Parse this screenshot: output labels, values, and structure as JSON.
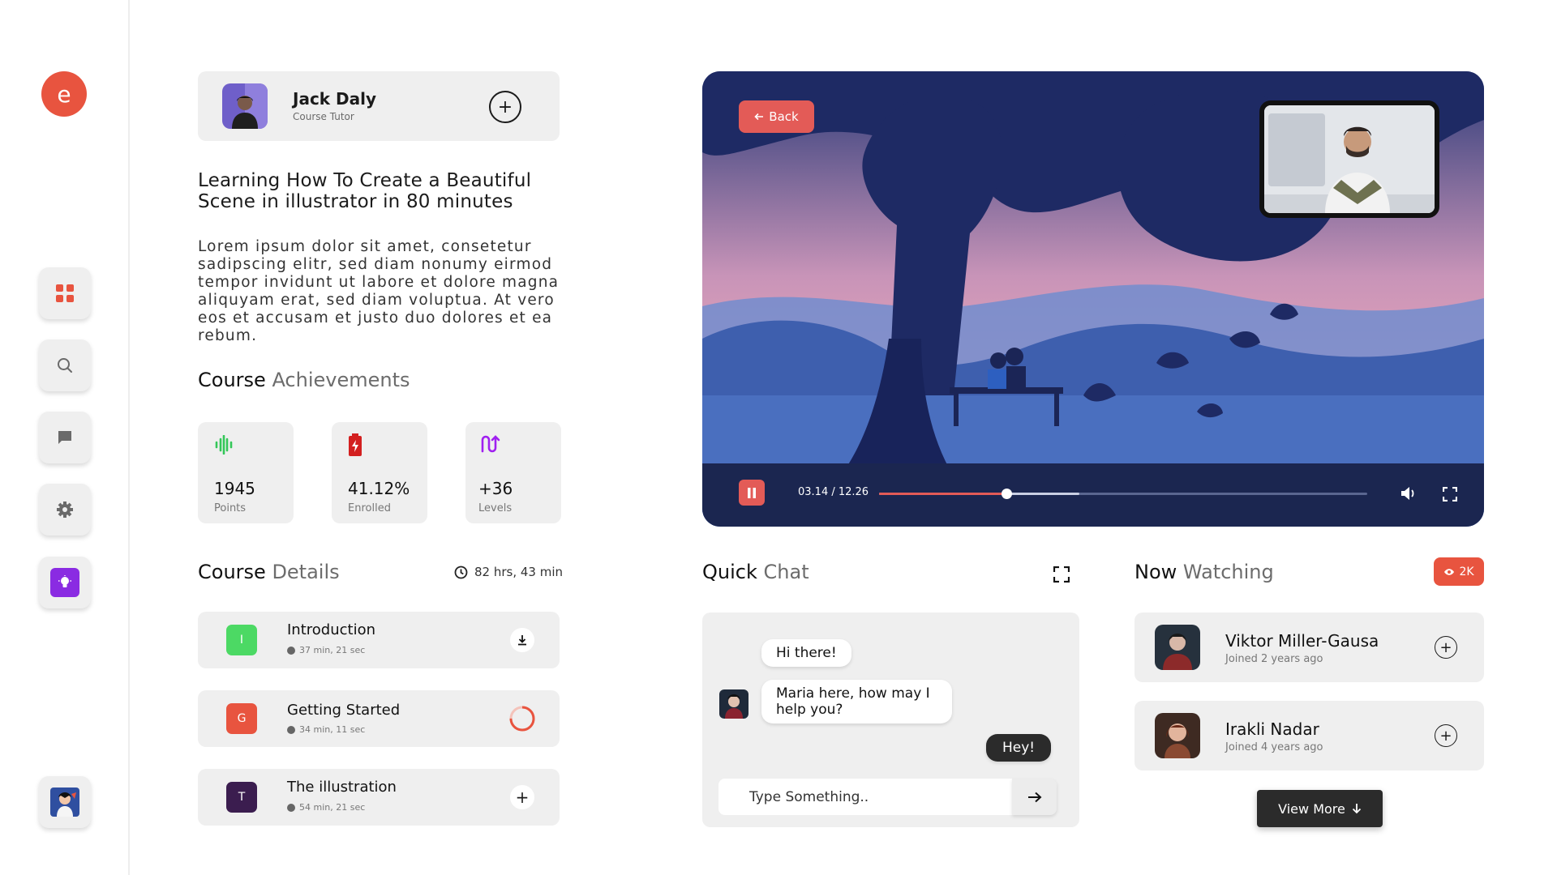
{
  "brand": {
    "logo_letter": "e",
    "accent": "#e8543f"
  },
  "sidebar": {
    "items": [
      {
        "name": "dashboard",
        "icon": "grid-icon",
        "active": true
      },
      {
        "name": "search",
        "icon": "search-icon"
      },
      {
        "name": "messages",
        "icon": "chat-icon"
      },
      {
        "name": "settings",
        "icon": "gear-icon"
      },
      {
        "name": "ideas",
        "icon": "bulb-icon",
        "color": "#8a2be2"
      }
    ]
  },
  "tutor": {
    "name": "Jack Daly",
    "role": "Course Tutor"
  },
  "course": {
    "title": "Learning How To Create a Beautiful Scene in illustrator in 80 minutes",
    "description": "Lorem ipsum dolor sit amet, consetetur sadipscing elitr, sed diam nonumy eirmod tempor invidunt ut labore et dolore magna aliquyam erat, sed diam voluptua. At vero eos et accusam et justo duo dolores et ea rebum."
  },
  "achievements": {
    "title_bold": "Course",
    "title_light": "Achievements",
    "items": [
      {
        "value": "1945",
        "label": "Points",
        "icon": "soundwave-icon",
        "color": "#34c759"
      },
      {
        "value": "41.12%",
        "label": "Enrolled",
        "icon": "battery-icon",
        "color": "#d32020"
      },
      {
        "value": "+36",
        "label": "Levels",
        "icon": "route-icon",
        "color": "#a020f0"
      }
    ]
  },
  "details": {
    "title_bold": "Course",
    "title_light": "Details",
    "duration": "82 hrs, 43 min",
    "lessons": [
      {
        "letter": "I",
        "name": "Introduction",
        "time": "37 min, 21 sec",
        "color": "#4cd964",
        "action": "download-icon"
      },
      {
        "letter": "G",
        "name": "Getting Started",
        "time": "34 min, 11 sec",
        "color": "#e8543f",
        "action": "progress-ring-icon"
      },
      {
        "letter": "T",
        "name": "The illustration",
        "time": "54 min, 21 sec",
        "color": "#3b1d4f",
        "action": "plus-icon"
      }
    ]
  },
  "video": {
    "back_label": "Back",
    "time": "03.14 / 12.26",
    "played_fraction": 0.26,
    "buffered_fraction": 0.41
  },
  "chat": {
    "title_bold": "Quick",
    "title_light": "Chat",
    "messages": [
      {
        "text": "Hi there!",
        "from": "agent"
      },
      {
        "text": "Maria here, how may I help you?",
        "from": "agent"
      },
      {
        "text": "Hey!",
        "from": "user"
      }
    ],
    "input_placeholder": "Type Something.."
  },
  "watching": {
    "title_bold": "Now",
    "title_light": "Watching",
    "views": "2K",
    "viewers": [
      {
        "name": "Viktor Miller-Gausa",
        "joined": "Joined 2 years ago"
      },
      {
        "name": "Irakli Nadar",
        "joined": "Joined 4 years ago"
      }
    ],
    "view_more_label": "View More"
  }
}
